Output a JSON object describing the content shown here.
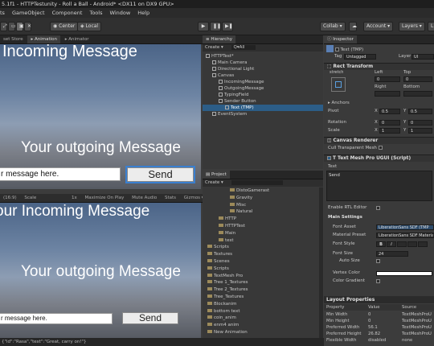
{
  "window": {
    "title": "5.1f1 - HTTPTestunity - Roll a Ball - Android* <DX11 on DX9 GPU>"
  },
  "menu": [
    "ts",
    "GameObject",
    "Component",
    "Tools",
    "Window",
    "Help"
  ],
  "toolbar": {
    "center": "Center",
    "local": "Local",
    "collab": "Collab ▾",
    "account": "Account ▾",
    "layers": "Layers ▾",
    "layout": "L"
  },
  "scene_tabs": [
    "set Store",
    "Animation",
    "Animator"
  ],
  "game_top": {
    "incoming": "Incoming Message",
    "outgoing": "Your outgoing Message",
    "input_text": "r message here.",
    "send": "Send"
  },
  "game_bottom_bar": {
    "aspect": "(16:9)",
    "scale": "Scale",
    "one": "1x",
    "maximize": "Maximize On Play",
    "mute": "Mute Audio",
    "stats": "Stats",
    "gizmos": "Gizmos ▾"
  },
  "game_bottom": {
    "incoming": "our Incoming Message",
    "outgoing": "Your outgoing Message",
    "input_text": "r message here.",
    "send": "Send"
  },
  "hierarchy": {
    "tab": "Hierarchy",
    "create": "Create ▾",
    "search": "Q▾All",
    "rows": [
      {
        "label": "HTTPTest*",
        "indent": 0
      },
      {
        "label": "Main Camera",
        "indent": 1
      },
      {
        "label": "Directional Light",
        "indent": 1
      },
      {
        "label": "Canvas",
        "indent": 1
      },
      {
        "label": "IncomingMessage",
        "indent": 2
      },
      {
        "label": "OutgoingMessage",
        "indent": 2
      },
      {
        "label": "TypingField",
        "indent": 2
      },
      {
        "label": "Sender Button",
        "indent": 2
      },
      {
        "label": "Text (TMP)",
        "indent": 3,
        "selected": true
      },
      {
        "label": "EventSystem",
        "indent": 1
      }
    ]
  },
  "project": {
    "tab": "Project",
    "create": "Create ▾",
    "rows": [
      {
        "label": "DistoGamerast",
        "indent": 2
      },
      {
        "label": "Gravity",
        "indent": 2
      },
      {
        "label": "Misc",
        "indent": 2
      },
      {
        "label": "Natural",
        "indent": 2
      },
      {
        "label": "HTTP",
        "indent": 1
      },
      {
        "label": "HTTPTest",
        "indent": 1
      },
      {
        "label": "Main",
        "indent": 1
      },
      {
        "label": "test",
        "indent": 1
      },
      {
        "label": "Scripts",
        "indent": 0
      },
      {
        "label": "Textures",
        "indent": 0
      },
      {
        "label": "Scenes",
        "indent": 0
      },
      {
        "label": "Scripts",
        "indent": 0
      },
      {
        "label": "TextMesh Pro",
        "indent": 0
      },
      {
        "label": "Tree 1_Textures",
        "indent": 0
      },
      {
        "label": "Tree 2_Textures",
        "indent": 0
      },
      {
        "label": "Tree_Textures",
        "indent": 0
      },
      {
        "label": "Blockanim",
        "indent": 0
      },
      {
        "label": "bottom text",
        "indent": 0
      },
      {
        "label": "coin_anim",
        "indent": 0
      },
      {
        "label": "enm4 anim",
        "indent": 0
      },
      {
        "label": "New Animation",
        "indent": 0
      }
    ]
  },
  "inspector": {
    "tab": "Inspector",
    "object_name": "Text (TMP)",
    "tag_label": "Tag",
    "tag_value": "Untagged",
    "layer_label": "Layer",
    "layer_value": "UI",
    "rect_transform": "Rect Transform",
    "stretch": "stretch",
    "left": "Left",
    "top": "Top",
    "v0a": "0",
    "v0b": "0",
    "right": "Right",
    "bottom": "Bottom",
    "anchors": "Anchors",
    "pivot": "Pivot",
    "pivot_x": "0.5",
    "pivot_y": "0.5",
    "rotation": "Rotation",
    "rot_x": "0",
    "rot_y": "0",
    "scale": "Scale",
    "scale_x": "1",
    "scale_y": "1",
    "canvas_renderer": "Canvas Renderer",
    "cull": "Cull Transparent Mesh",
    "tmp_component": "Text Mesh Pro UGUI (Script)",
    "text_label": "Text",
    "text_value": "Send",
    "rtl": "Enable RTL Editor",
    "main_settings": "Main Settings",
    "font_asset": "Font Asset",
    "font_asset_value": "LiberationSans SDF (TMP",
    "material_preset": "Material Preset",
    "material_value": "LiberationSans SDF Materia",
    "font_style": "Font Style",
    "font_style_b": "B",
    "font_style_i": "I",
    "font_size": "Font Size",
    "font_size_value": "24",
    "auto_size": "Auto Size",
    "vertex_color": "Vertex Color",
    "color_gradient": "Color Gradient"
  },
  "layout_properties": {
    "title": "Layout Properties",
    "headers": [
      "Property",
      "Value",
      "Source"
    ],
    "rows": [
      [
        "Min Width",
        "0",
        "TextMeshProU"
      ],
      [
        "Min Height",
        "0",
        "TextMeshProU"
      ],
      [
        "Preferred Width",
        "56.1",
        "TextMeshProU"
      ],
      [
        "Preferred Height",
        "26.82",
        "TextMeshProU"
      ],
      [
        "Flexible Width",
        "disabled",
        "none"
      ]
    ]
  },
  "status": "{\"id\":\"Rasa\",\"text\":\"Great, carry on!\"}"
}
